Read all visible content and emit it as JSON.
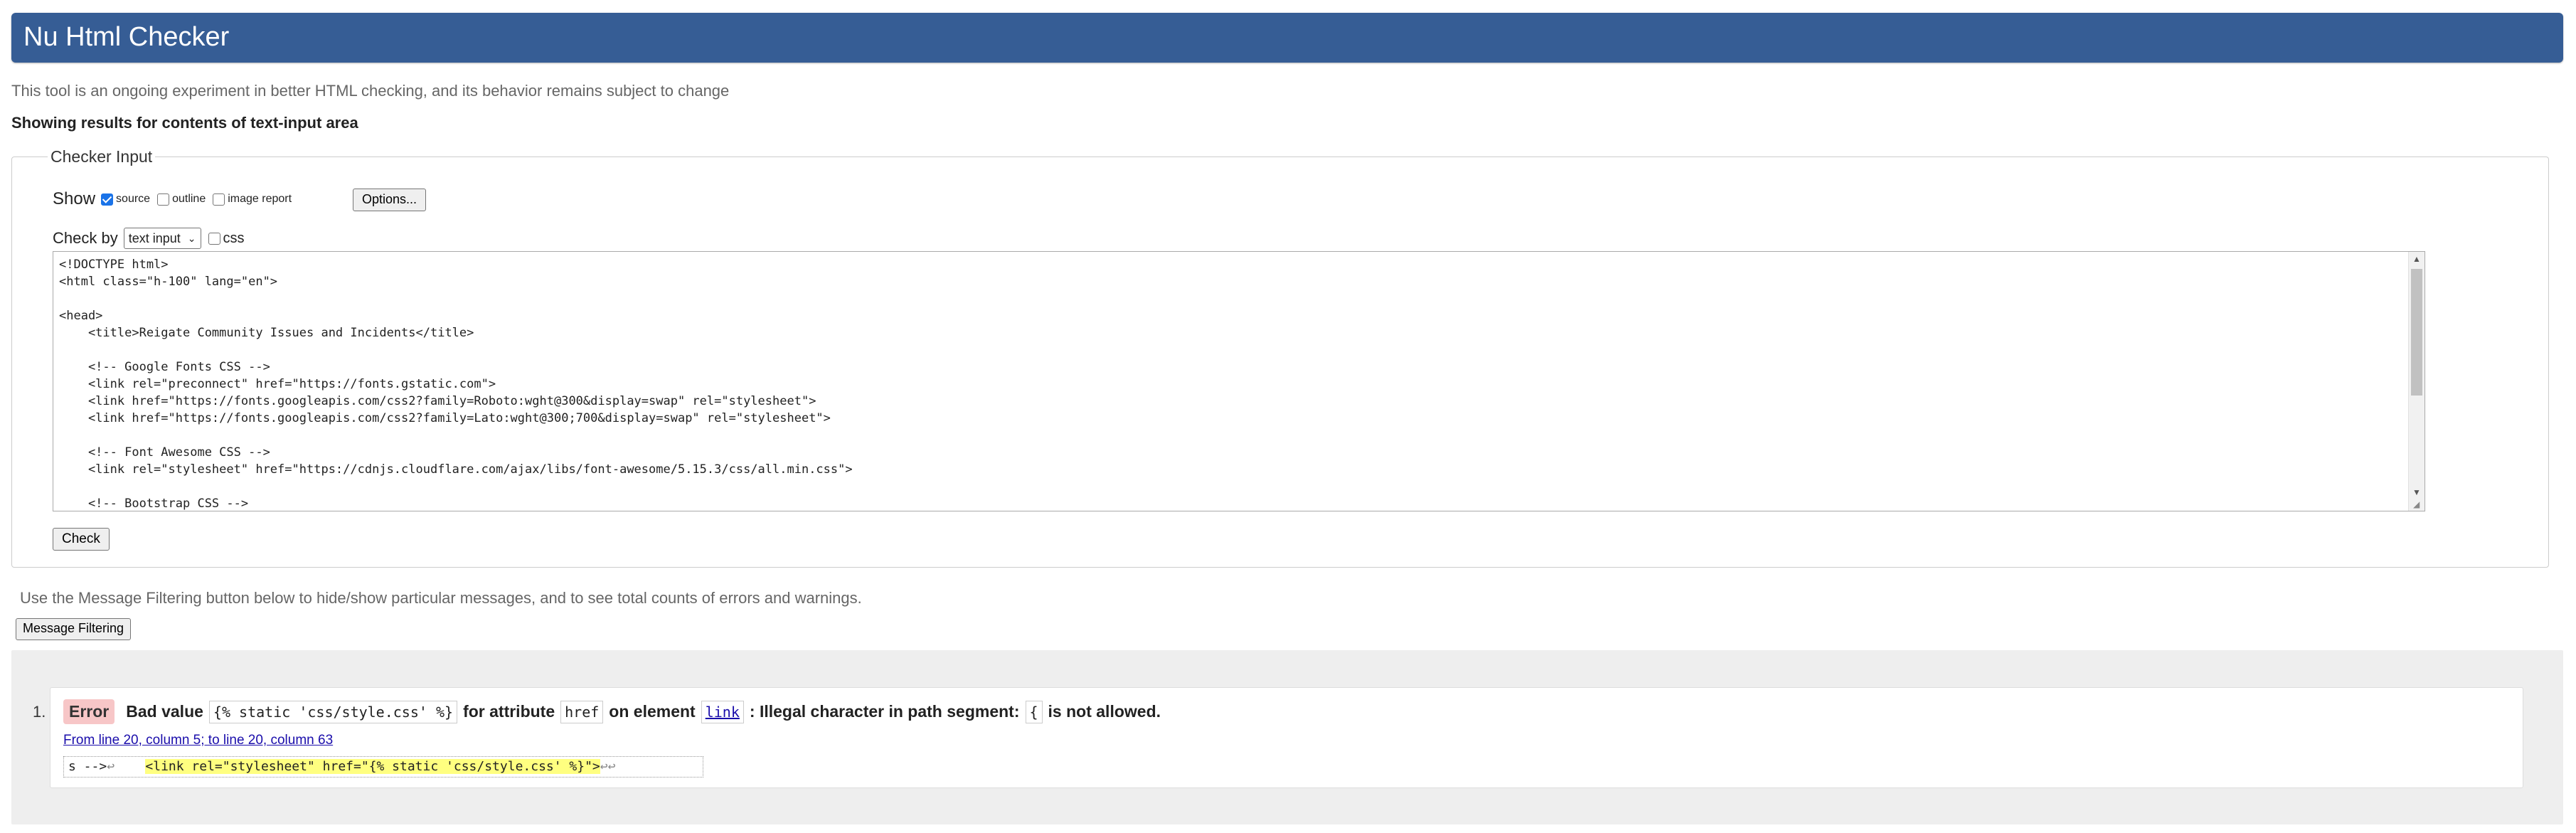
{
  "header": {
    "title": "Nu Html Checker"
  },
  "intro": "This tool is an ongoing experiment in better HTML checking, and its behavior remains subject to change",
  "showing": "Showing results for contents of text-input area",
  "checker_input": {
    "legend": "Checker Input",
    "show_label": "Show",
    "show_options": [
      {
        "label": "source",
        "checked": true
      },
      {
        "label": "outline",
        "checked": false
      },
      {
        "label": "image report",
        "checked": false
      }
    ],
    "options_button": "Options...",
    "check_by_label": "Check by",
    "check_by_value": "text input",
    "css_label": "css",
    "css_checked": false,
    "source_text": "<!DOCTYPE html>\n<html class=\"h-100\" lang=\"en\">\n\n<head>\n    <title>Reigate Community Issues and Incidents</title>\n\n    <!-- Google Fonts CSS -->\n    <link rel=\"preconnect\" href=\"https://fonts.gstatic.com\">\n    <link href=\"https://fonts.googleapis.com/css2?family=Roboto:wght@300&display=swap\" rel=\"stylesheet\">\n    <link href=\"https://fonts.googleapis.com/css2?family=Lato:wght@300;700&display=swap\" rel=\"stylesheet\">\n\n    <!-- Font Awesome CSS -->\n    <link rel=\"stylesheet\" href=\"https://cdnjs.cloudflare.com/ajax/libs/font-awesome/5.15.3/css/all.min.css\">\n\n    <!-- Bootstrap CSS -->",
    "check_button": "Check"
  },
  "filter_note": "Use the Message Filtering button below to hide/show particular messages, and to see total counts of errors and warnings.",
  "filter_button": "Message Filtering",
  "messages": [
    {
      "number": "1.",
      "type": "Error",
      "text_bad_value": "Bad value",
      "value": "{% static 'css/style.css' %}",
      "text_for_attribute": "for attribute",
      "attribute": "href",
      "text_on_element": "on element",
      "element": "link",
      "text_illegal": ": Illegal character in path segment:",
      "char": "{",
      "text_not_allowed": "is not allowed.",
      "location": "From line 20, column 5; to line 20, column 63",
      "extract_before": "s -->",
      "extract_highlight": "<link rel=\"stylesheet\" href=\"{% static 'css/style.css' %}\">",
      "return_symbol": "↩"
    }
  ]
}
